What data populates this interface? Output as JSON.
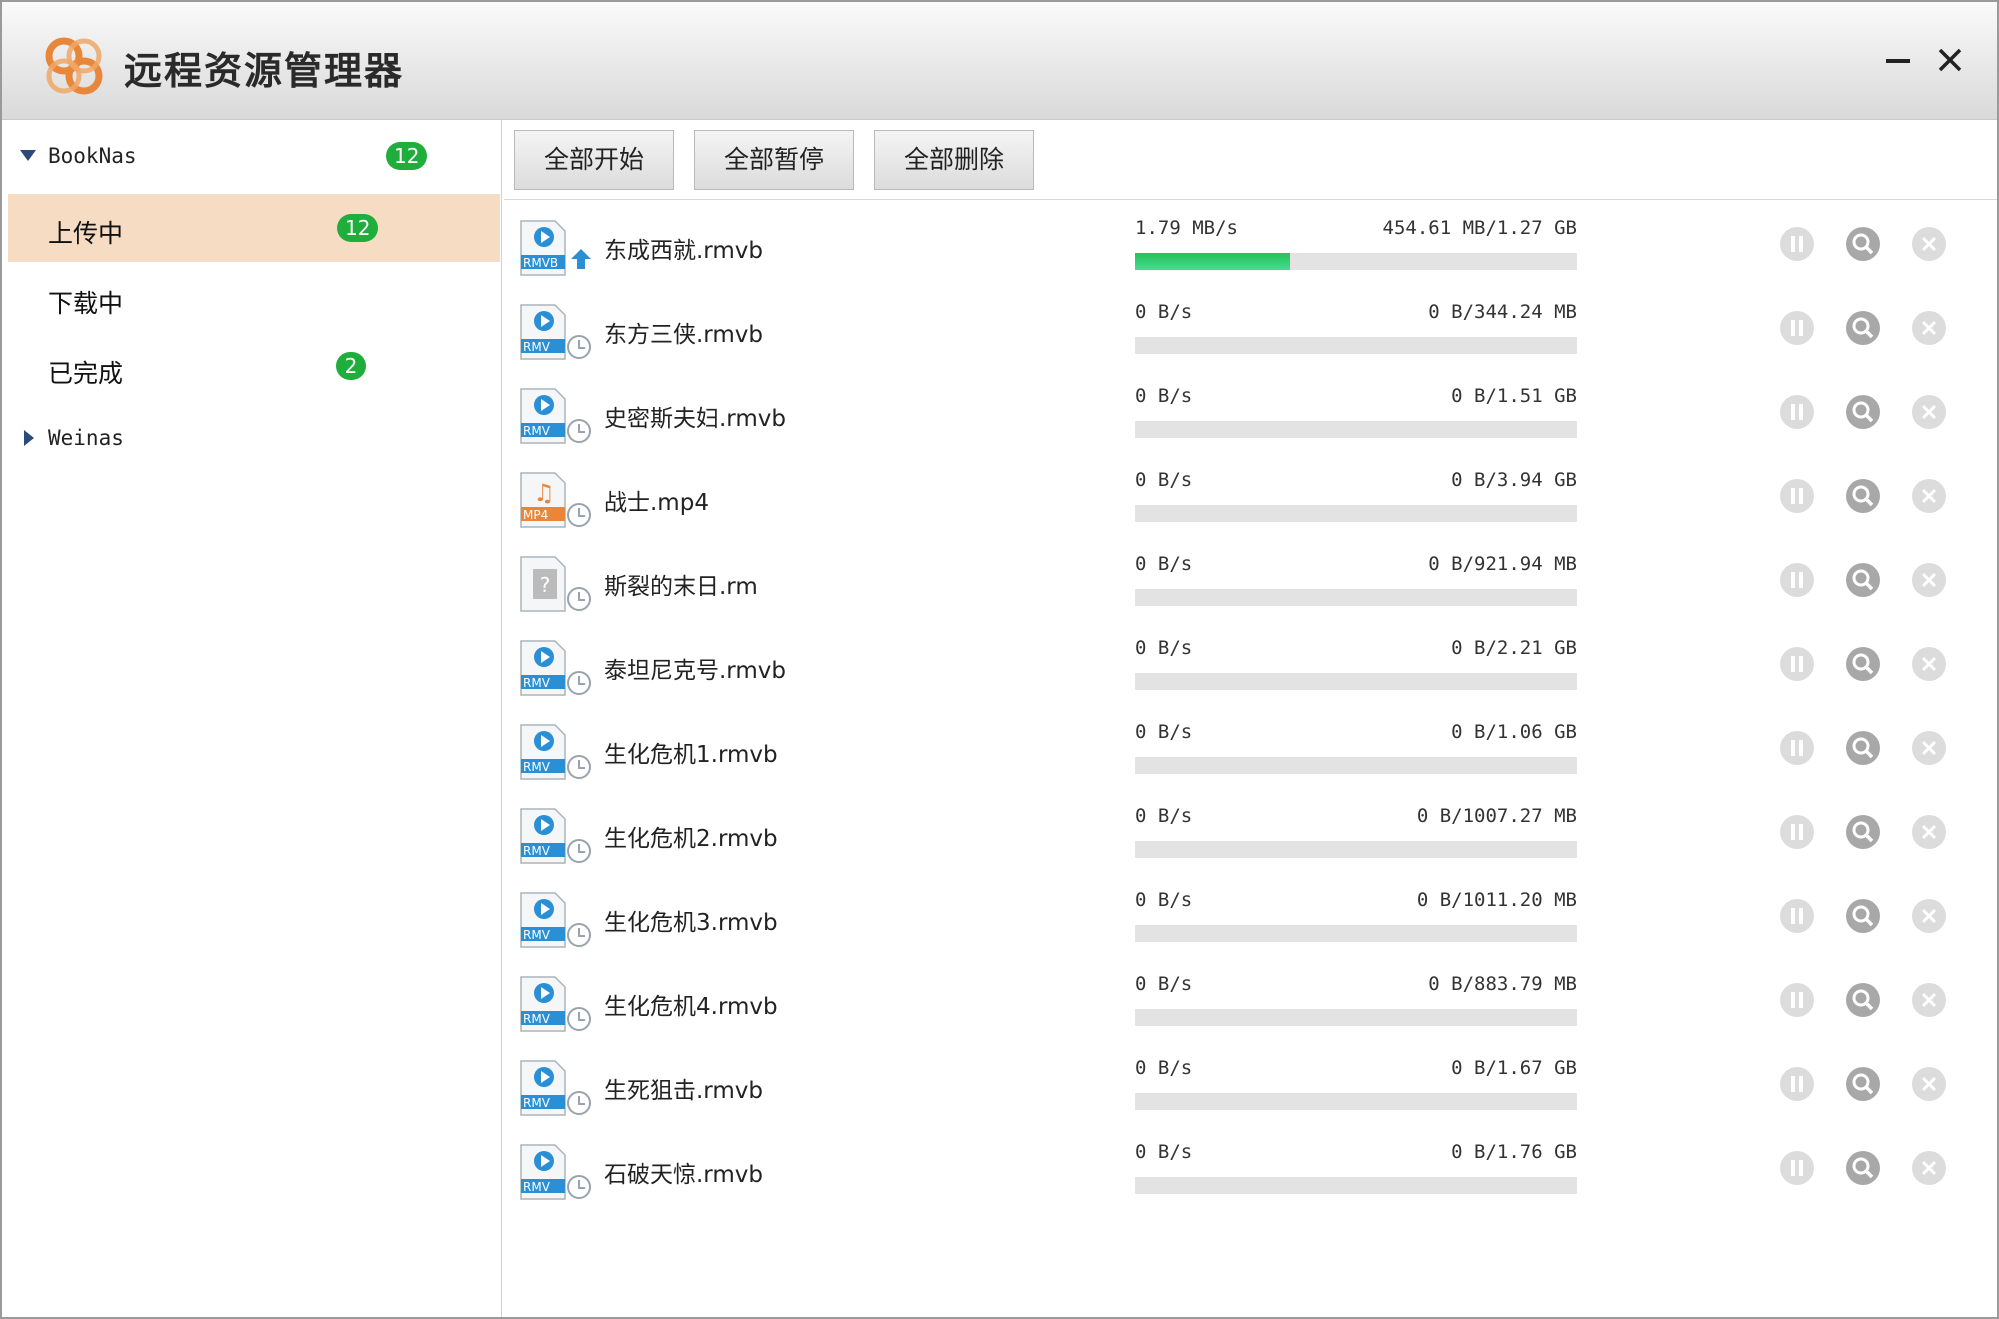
{
  "window": {
    "title": "远程资源管理器"
  },
  "colors": {
    "accent_orange": "#e8873a",
    "badge_green": "#1fae3c",
    "progress_green": "#2ecc71",
    "selected_bg": "#f6dcc2"
  },
  "sidebar": {
    "groups": [
      {
        "label": "BookNas",
        "badge": "12",
        "expanded": true,
        "items": [
          {
            "label": "上传中",
            "badge": "12",
            "active": true
          },
          {
            "label": "下载中",
            "badge": ""
          },
          {
            "label": "已完成",
            "badge": "2"
          }
        ]
      },
      {
        "label": "Weinas",
        "badge": "",
        "expanded": false
      }
    ]
  },
  "toolbar": {
    "start_all": "全部开始",
    "pause_all": "全部暂停",
    "delete_all": "全部删除"
  },
  "tasks": [
    {
      "name": "东成西就.rmvb",
      "speed": "1.79 MB/s",
      "size": "454.61 MB/1.27 GB",
      "progress": 0.35,
      "icon": "rmvb-uploading-icon",
      "tag": "RMVB"
    },
    {
      "name": "东方三侠.rmvb",
      "speed": "0 B/s",
      "size": "0 B/344.24 MB",
      "progress": 0,
      "icon": "rmvb-waiting-icon",
      "tag": "RMV"
    },
    {
      "name": "史密斯夫妇.rmvb",
      "speed": "0 B/s",
      "size": "0 B/1.51 GB",
      "progress": 0,
      "icon": "rmvb-waiting-icon",
      "tag": "RMV"
    },
    {
      "name": "战士.mp4",
      "speed": "0 B/s",
      "size": "0 B/3.94 GB",
      "progress": 0,
      "icon": "mp4-waiting-icon",
      "tag": "MP4"
    },
    {
      "name": "斯裂的末日.rm",
      "speed": "0 B/s",
      "size": "0 B/921.94 MB",
      "progress": 0,
      "icon": "unknown-file-waiting-icon",
      "tag": ""
    },
    {
      "name": "泰坦尼克号.rmvb",
      "speed": "0 B/s",
      "size": "0 B/2.21 GB",
      "progress": 0,
      "icon": "rmvb-waiting-icon",
      "tag": "RMV"
    },
    {
      "name": "生化危机1.rmvb",
      "speed": "0 B/s",
      "size": "0 B/1.06 GB",
      "progress": 0,
      "icon": "rmvb-waiting-icon",
      "tag": "RMV"
    },
    {
      "name": "生化危机2.rmvb",
      "speed": "0 B/s",
      "size": "0 B/1007.27 MB",
      "progress": 0,
      "icon": "rmvb-waiting-icon",
      "tag": "RMV"
    },
    {
      "name": "生化危机3.rmvb",
      "speed": "0 B/s",
      "size": "0 B/1011.20 MB",
      "progress": 0,
      "icon": "rmvb-waiting-icon",
      "tag": "RMV"
    },
    {
      "name": "生化危机4.rmvb",
      "speed": "0 B/s",
      "size": "0 B/883.79 MB",
      "progress": 0,
      "icon": "rmvb-waiting-icon",
      "tag": "RMV"
    },
    {
      "name": "生死狙击.rmvb",
      "speed": "0 B/s",
      "size": "0 B/1.67 GB",
      "progress": 0,
      "icon": "rmvb-waiting-icon",
      "tag": "RMV"
    },
    {
      "name": "石破天惊.rmvb",
      "speed": "0 B/s",
      "size": "0 B/1.76 GB",
      "progress": 0,
      "icon": "rmvb-waiting-icon",
      "tag": "RMV"
    }
  ]
}
